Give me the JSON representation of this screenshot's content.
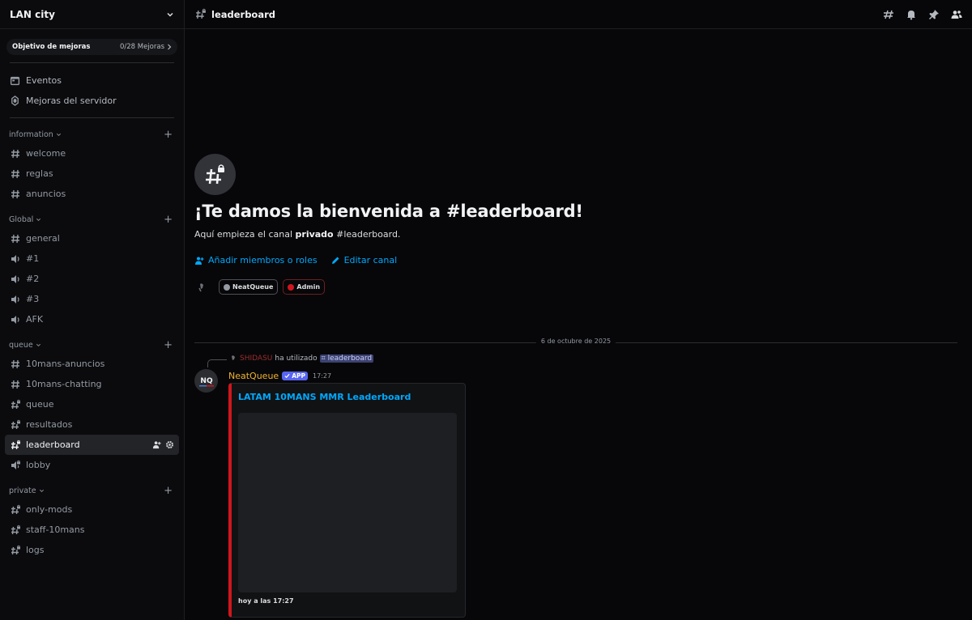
{
  "server": {
    "name": "LAN city"
  },
  "boost": {
    "title": "Objetivo de mejoras",
    "count": "0/28 Mejoras"
  },
  "utility": [
    {
      "label": "Eventos",
      "icon": "calendar-icon"
    },
    {
      "label": "Mejoras del servidor",
      "icon": "boost-shield-icon"
    }
  ],
  "categories": [
    {
      "name": "information",
      "channels": [
        {
          "label": "welcome",
          "type": "text"
        },
        {
          "label": "reglas",
          "type": "text"
        },
        {
          "label": "anuncios",
          "type": "text"
        }
      ]
    },
    {
      "name": "Global",
      "channels": [
        {
          "label": "general",
          "type": "text"
        },
        {
          "label": "#1",
          "type": "voice"
        },
        {
          "label": "#2",
          "type": "voice"
        },
        {
          "label": "#3",
          "type": "voice"
        },
        {
          "label": "AFK",
          "type": "voice"
        }
      ]
    },
    {
      "name": "queue",
      "channels": [
        {
          "label": "10mans-anuncios",
          "type": "text"
        },
        {
          "label": "10mans-chatting",
          "type": "text"
        },
        {
          "label": "queue",
          "type": "text-locked"
        },
        {
          "label": "resultados",
          "type": "text-locked"
        },
        {
          "label": "leaderboard",
          "type": "text-locked",
          "active": true
        },
        {
          "label": "lobby",
          "type": "voice-locked"
        }
      ]
    },
    {
      "name": "private",
      "channels": [
        {
          "label": "only-mods",
          "type": "text-locked"
        },
        {
          "label": "staff-10mans",
          "type": "text-locked"
        },
        {
          "label": "logs",
          "type": "text-locked"
        }
      ]
    }
  ],
  "channel": {
    "name": "leaderboard"
  },
  "welcome": {
    "title": "¡Te damos la bienvenida a #leaderboard!",
    "sub_prefix": "Aquí empieza el canal ",
    "sub_bold": "privado",
    "sub_suffix": " #leaderboard.",
    "add_members": "Añadir miembros o roles",
    "edit_channel": "Editar canal",
    "roles": [
      {
        "label": "NeatQueue",
        "color": "#949ba4"
      },
      {
        "label": "Admin",
        "color": "#d0161d"
      }
    ]
  },
  "date_divider": "6 de octubre de 2025",
  "message": {
    "reply_user": "SHIDASU",
    "reply_text": "ha utilizado",
    "reply_command": "leaderboard",
    "author": "NeatQueue",
    "badge": "APP",
    "time": "17:27",
    "embed_title": "LATAM 10MANS MMR Leaderboard",
    "embed_footer": "hoy a las 17:27",
    "avatar_text": "NQ"
  },
  "colors": {
    "accent": "#00a8fc",
    "embed_border": "#d0161d",
    "author": "#f0b232",
    "app_badge": "#5865f2"
  }
}
